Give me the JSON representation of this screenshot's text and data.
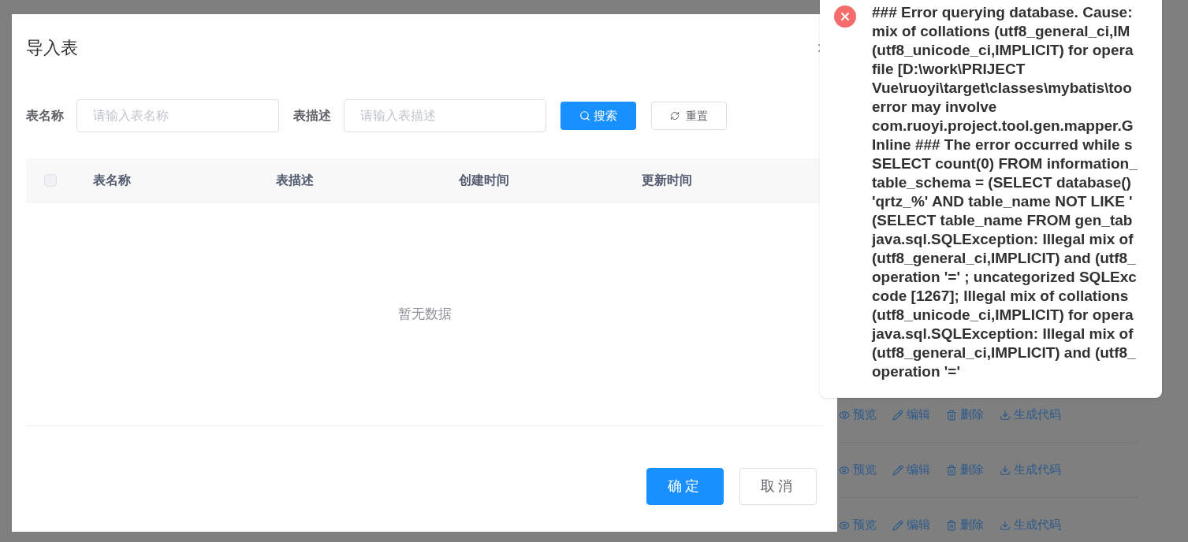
{
  "dialog": {
    "title": "导入表",
    "filters": [
      {
        "label": "表名称",
        "placeholder": "请输入表名称"
      },
      {
        "label": "表描述",
        "placeholder": "请输入表描述"
      }
    ],
    "search_button": "搜索",
    "reset_button": "重置",
    "table": {
      "select_all": {
        "checked": false
      },
      "columns": [
        "表名称",
        "表描述",
        "创建时间",
        "更新时间"
      ],
      "empty_text": "暂无数据"
    },
    "footer_buttons": [
      {
        "label": "确定",
        "kind": "primary"
      },
      {
        "label": "取消",
        "kind": "default"
      }
    ]
  },
  "notification": {
    "kind": "error",
    "lines": [
      "### Error querying database. Cause:",
      "mix of collations (utf8_general_ci,IM",
      "(utf8_unicode_ci,IMPLICIT) for opera",
      "file [D:\\work\\PRIJECT",
      "Vue\\ruoyi\\target\\classes\\mybatis\\too",
      "error may involve",
      "com.ruoyi.project.tool.gen.mapper.G",
      "Inline ### The error occurred while s",
      "SELECT count(0) FROM information_",
      "table_schema = (SELECT database()",
      "'qrtz_%' AND table_name NOT LIKE '",
      "(SELECT table_name FROM gen_tab",
      "java.sql.SQLException: Illegal mix of",
      "(utf8_general_ci,IMPLICIT) and (utf8_",
      "operation '=' ; uncategorized SQLExc",
      "code [1267]; Illegal mix of collations",
      "(utf8_unicode_ci,IMPLICIT) for opera",
      "java.sql.SQLException: Illegal mix of",
      "(utf8_general_ci,IMPLICIT) and (utf8_",
      "operation '='"
    ]
  },
  "background_rows": [
    {
      "actions": [
        {
          "kind": "preview",
          "label": "预览"
        },
        {
          "kind": "edit",
          "label": "编辑"
        },
        {
          "kind": "delete",
          "label": "删除"
        },
        {
          "kind": "generate",
          "label": "生成代码"
        }
      ]
    },
    {
      "actions": [
        {
          "kind": "preview",
          "label": "预览"
        },
        {
          "kind": "edit",
          "label": "编辑"
        },
        {
          "kind": "delete",
          "label": "删除"
        },
        {
          "kind": "generate",
          "label": "生成代码"
        }
      ]
    },
    {
      "actions": [
        {
          "kind": "preview",
          "label": "预览"
        },
        {
          "kind": "edit",
          "label": "编辑"
        },
        {
          "kind": "delete",
          "label": "删除"
        },
        {
          "kind": "generate",
          "label": "生成代码"
        }
      ]
    }
  ]
}
